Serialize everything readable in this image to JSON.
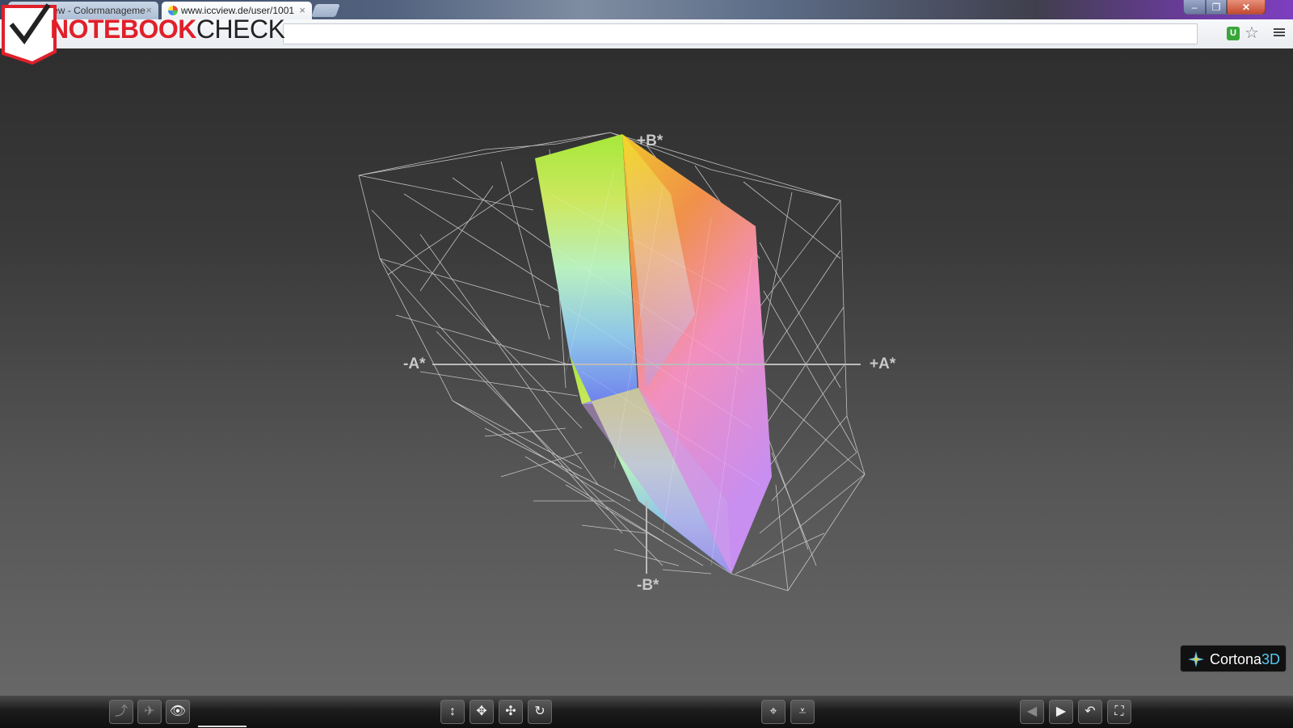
{
  "browser": {
    "tabs": [
      {
        "label": "ICCView - Colormanageme",
        "close": "×"
      },
      {
        "label": "www.iccview.de/user/1001",
        "close": "×"
      }
    ],
    "window_buttons": {
      "minimize": "–",
      "maximize": "❐",
      "close": "✕"
    },
    "extension_badge": "U",
    "star_icon": "star-icon",
    "menu_icon": "menu-icon"
  },
  "watermark": {
    "brand_part1": "NOTEBOOK",
    "brand_part2": "CHECK"
  },
  "viewer": {
    "axes": {
      "plus_b": "+B*",
      "minus_b": "-B*",
      "minus_a": "-A*",
      "plus_a": "+A*"
    },
    "badge": {
      "name": "Cortona",
      "suffix": "3D"
    },
    "colors": {
      "background_top": "#2e2e2e",
      "background_bottom": "#676767",
      "wireframe": "#d8d8d8",
      "axis": "#bbbbbb"
    }
  },
  "toolbar": {
    "buttons": [
      {
        "name": "walk-button",
        "icon": "walk-icon",
        "glyph": "⤴",
        "dim": true
      },
      {
        "name": "fly-button",
        "icon": "plane-icon",
        "glyph": "✈",
        "dim": true
      },
      {
        "name": "study-button",
        "icon": "eye-icon",
        "glyph": "👁",
        "dim": false
      },
      {
        "name": "plan-button",
        "icon": "arrow-updown-icon",
        "glyph": "↕",
        "dim": false
      },
      {
        "name": "pan-button",
        "icon": "move-icon",
        "glyph": "✥",
        "dim": false
      },
      {
        "name": "turn-button",
        "icon": "turn-icon",
        "glyph": "✣",
        "dim": false
      },
      {
        "name": "roll-button",
        "icon": "roll-icon",
        "glyph": "↻",
        "dim": false
      },
      {
        "name": "goto-button",
        "icon": "target-icon",
        "glyph": "⌖",
        "dim": false
      },
      {
        "name": "align-button",
        "icon": "align-icon",
        "glyph": "⩡",
        "dim": false
      },
      {
        "name": "prev-viewpoint-button",
        "icon": "prev-icon",
        "glyph": "◀",
        "dim": true
      },
      {
        "name": "next-viewpoint-button",
        "icon": "play-icon",
        "glyph": "▶",
        "dim": false
      },
      {
        "name": "restore-button",
        "icon": "undo-icon",
        "glyph": "↶",
        "dim": false
      },
      {
        "name": "fit-button",
        "icon": "fit-icon",
        "glyph": "⛶",
        "dim": false
      }
    ]
  }
}
